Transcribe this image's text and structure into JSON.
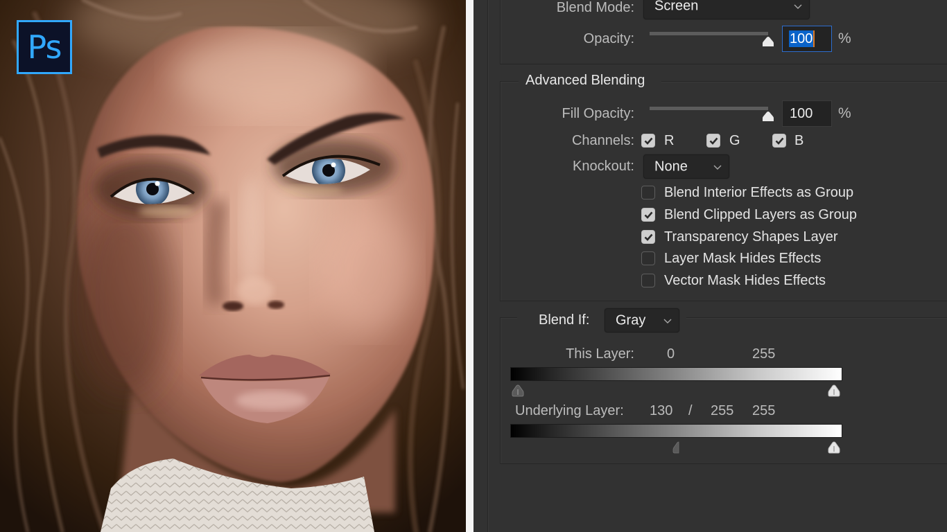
{
  "logo": {
    "text": "Ps",
    "brand_color": "#31a8ff"
  },
  "blending_options": {
    "blend_mode": {
      "label": "Blend Mode:",
      "value": "Screen"
    },
    "opacity": {
      "label": "Opacity:",
      "value": "100",
      "unit": "%",
      "percent": 100,
      "text_selected": true
    }
  },
  "advanced_blending": {
    "title": "Advanced Blending",
    "fill_opacity": {
      "label": "Fill Opacity:",
      "value": "100",
      "unit": "%",
      "percent": 100
    },
    "channels": {
      "label": "Channels:",
      "items": [
        {
          "label": "R",
          "checked": true
        },
        {
          "label": "G",
          "checked": true
        },
        {
          "label": "B",
          "checked": true
        }
      ]
    },
    "knockout": {
      "label": "Knockout:",
      "value": "None"
    },
    "options": [
      {
        "label": "Blend Interior Effects as Group",
        "checked": false
      },
      {
        "label": "Blend Clipped Layers as Group",
        "checked": true
      },
      {
        "label": "Transparency Shapes Layer",
        "checked": true
      },
      {
        "label": "Layer Mask Hides Effects",
        "checked": false
      },
      {
        "label": "Vector Mask Hides Effects",
        "checked": false
      }
    ]
  },
  "blend_if": {
    "label": "Blend If:",
    "channel": "Gray",
    "this_layer": {
      "label": "This Layer:",
      "black": "0",
      "white": "255"
    },
    "underlying_layer": {
      "label": "Underlying Layer:",
      "black_low": "130",
      "separator": "/",
      "black_high": "255",
      "white": "255"
    }
  },
  "colors": {
    "panel_bg": "#323232",
    "selection": "#0a63c9",
    "focus_border": "#2d6ed0",
    "brand": "#31a8ff"
  }
}
